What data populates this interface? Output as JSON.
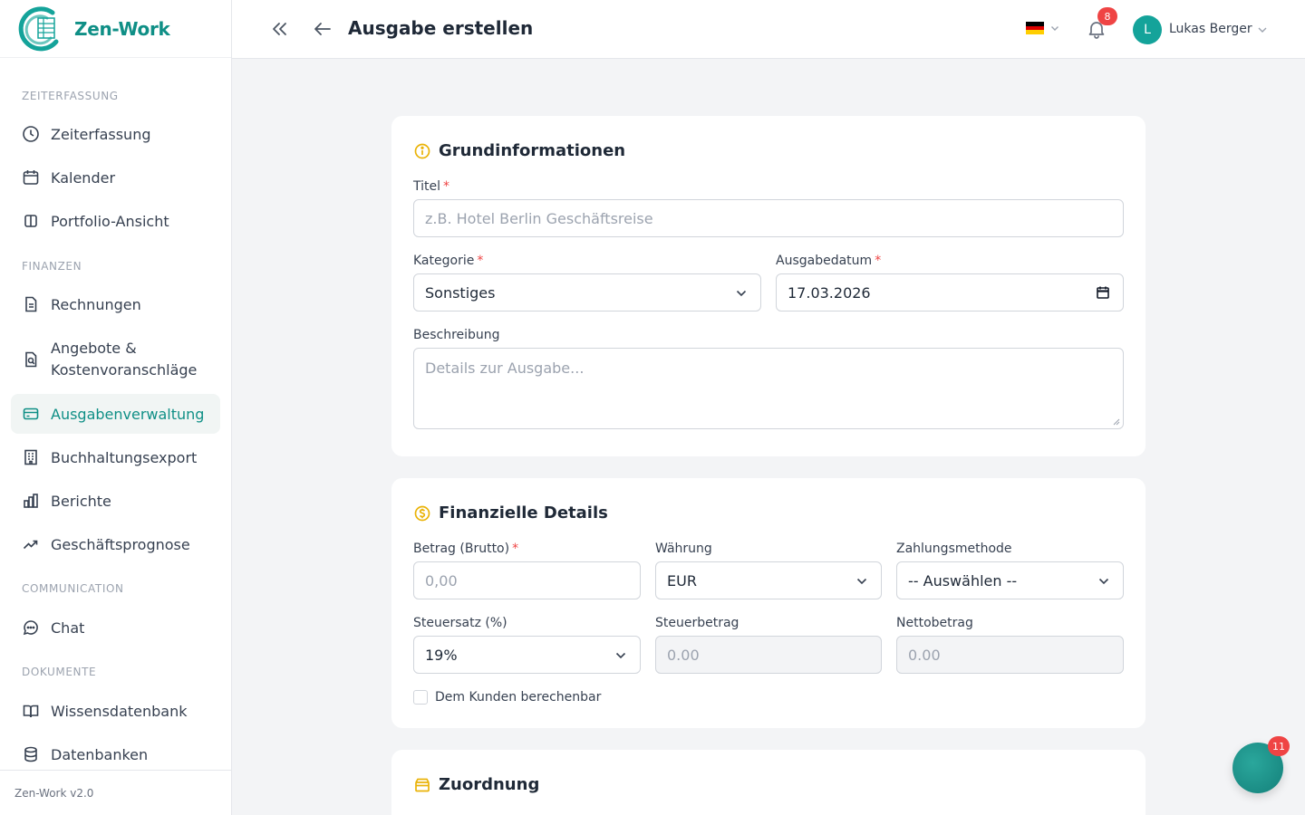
{
  "app": {
    "name": "Zen-Work",
    "version": "Zen-Work v2.0",
    "accent": "#0f8f86"
  },
  "sidebar": {
    "sections": [
      {
        "label": "ZEITERFASSUNG",
        "items": [
          {
            "label": "Zeiterfassung",
            "icon": "clock-icon"
          },
          {
            "label": "Kalender",
            "icon": "calendar-icon"
          },
          {
            "label": "Portfolio-Ansicht",
            "icon": "columns-icon"
          }
        ]
      },
      {
        "label": "FINANZEN",
        "items": [
          {
            "label": "Rechnungen",
            "icon": "document-icon"
          },
          {
            "label": "Angebote & Kostenvoranschläge",
            "icon": "file-search-icon"
          },
          {
            "label": "Ausgabenverwaltung",
            "icon": "credit-card-icon",
            "active": true
          },
          {
            "label": "Buchhaltungsexport",
            "icon": "building-icon"
          },
          {
            "label": "Berichte",
            "icon": "bar-chart-icon"
          },
          {
            "label": "Geschäftsprognose",
            "icon": "trending-up-icon"
          }
        ]
      },
      {
        "label": "COMMUNICATION",
        "items": [
          {
            "label": "Chat",
            "icon": "chat-icon"
          }
        ]
      },
      {
        "label": "DOKUMENTE",
        "items": [
          {
            "label": "Wissensdatenbank",
            "icon": "book-icon"
          },
          {
            "label": "Datenbanken",
            "icon": "database-icon"
          }
        ]
      }
    ]
  },
  "header": {
    "title": "Ausgabe erstellen",
    "notifications_count": "8",
    "user": {
      "initial": "L",
      "name": "Lukas Berger"
    }
  },
  "basic": {
    "title": "Grundinformationen",
    "titel_label": "Titel",
    "titel_placeholder": "z.B. Hotel Berlin Geschäftsreise",
    "kategorie_label": "Kategorie",
    "kategorie_value": "Sonstiges",
    "datum_label": "Ausgabedatum",
    "datum_value": "17.03.2026",
    "beschreibung_label": "Beschreibung",
    "beschreibung_placeholder": "Details zur Ausgabe..."
  },
  "financial": {
    "title": "Finanzielle Details",
    "betrag_label": "Betrag (Brutto)",
    "betrag_placeholder": "0,00",
    "waehrung_label": "Währung",
    "waehrung_value": "EUR",
    "zahlungsmethode_label": "Zahlungsmethode",
    "zahlungsmethode_value": "-- Auswählen --",
    "steuersatz_label": "Steuersatz (%)",
    "steuersatz_value": "19%",
    "steuerbetrag_label": "Steuerbetrag",
    "steuerbetrag_value": "0.00",
    "nettobetrag_label": "Nettobetrag",
    "nettobetrag_value": "0.00",
    "billable_label": "Dem Kunden berechenbar"
  },
  "assignment": {
    "title": "Zuordnung"
  },
  "fab": {
    "badge": "11"
  }
}
